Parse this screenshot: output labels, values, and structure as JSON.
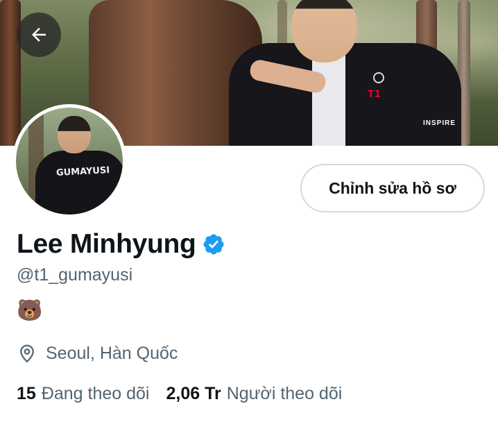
{
  "profile": {
    "name": "Lee Minhyung",
    "handle": "@t1_gumayusi",
    "bio": "🐻",
    "location": "Seoul, Hàn Quốc",
    "verified": true,
    "edit_button_label": "Chỉnh sửa hồ sơ"
  },
  "stats": {
    "following_count": "15",
    "following_label": "Đang theo dõi",
    "followers_count": "2,06 Tr",
    "followers_label": "Người theo dõi"
  },
  "banner": {
    "jacket_text": "T1",
    "patch_text": "INSPIRE"
  },
  "avatar": {
    "jersey_text": "GUMAYUSI"
  },
  "icons": {
    "back": "arrow-left-icon",
    "verified": "verified-badge-icon",
    "location": "location-pin-icon"
  },
  "colors": {
    "verified_blue": "#1d9bf0",
    "secondary_text": "#536471",
    "primary_text": "#0f1419",
    "button_border": "#cfd9de"
  }
}
